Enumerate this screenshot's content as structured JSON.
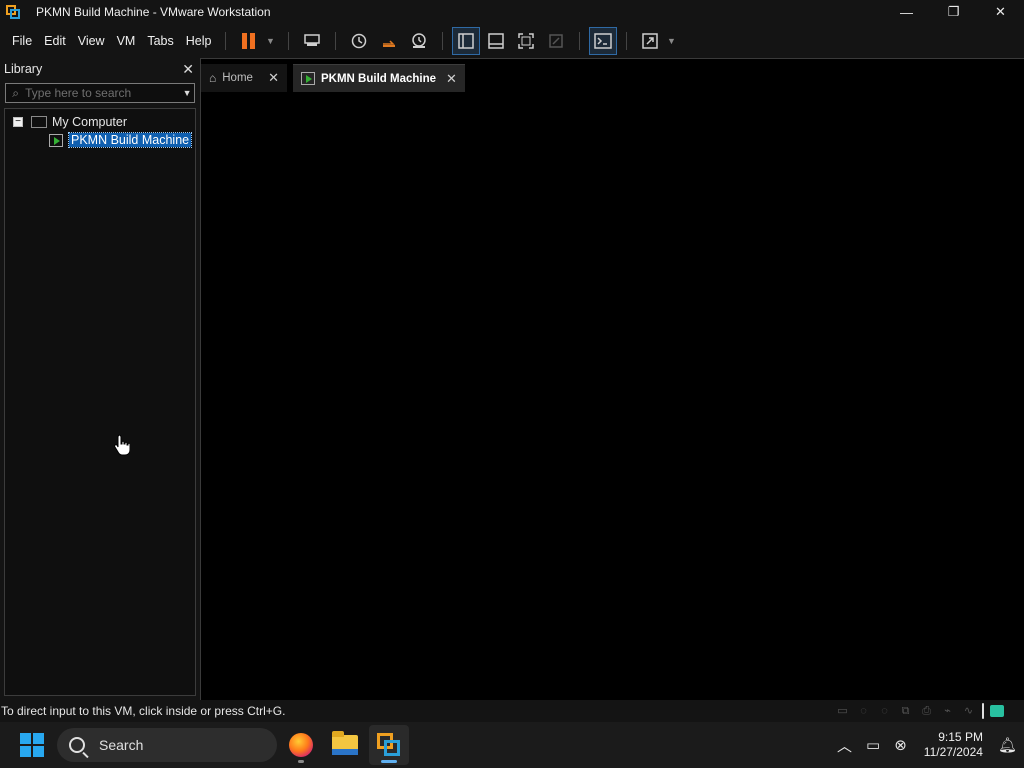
{
  "window": {
    "title": "PKMN Build Machine - VMware Workstation",
    "controls": {
      "minimize": "—",
      "restore": "❐",
      "close": "✕"
    }
  },
  "menu": [
    "File",
    "Edit",
    "View",
    "VM",
    "Tabs",
    "Help"
  ],
  "library": {
    "title": "Library",
    "close": "✕",
    "search_placeholder": "Type here to search",
    "tree": {
      "root": "My Computer",
      "expander": "−",
      "children": [
        "PKMN Build Machine"
      ]
    }
  },
  "tabs": [
    {
      "label": "Home",
      "icon": "home-icon",
      "close": "✕"
    },
    {
      "label": "PKMN Build Machine",
      "icon": "vm-icon",
      "close": "✕"
    }
  ],
  "status": {
    "message": "To direct input to this VM, click inside or press Ctrl+G."
  },
  "taskbar": {
    "search_label": "Search",
    "time": "9:15 PM",
    "date": "11/27/2024",
    "apps": [
      "firefox",
      "file-explorer",
      "vmware-workstation"
    ]
  },
  "colors": {
    "accent": "#0f5fb0",
    "pause": "#f07020",
    "vmware_orange": "#f0a020",
    "vmware_blue": "#2a9fd8"
  }
}
